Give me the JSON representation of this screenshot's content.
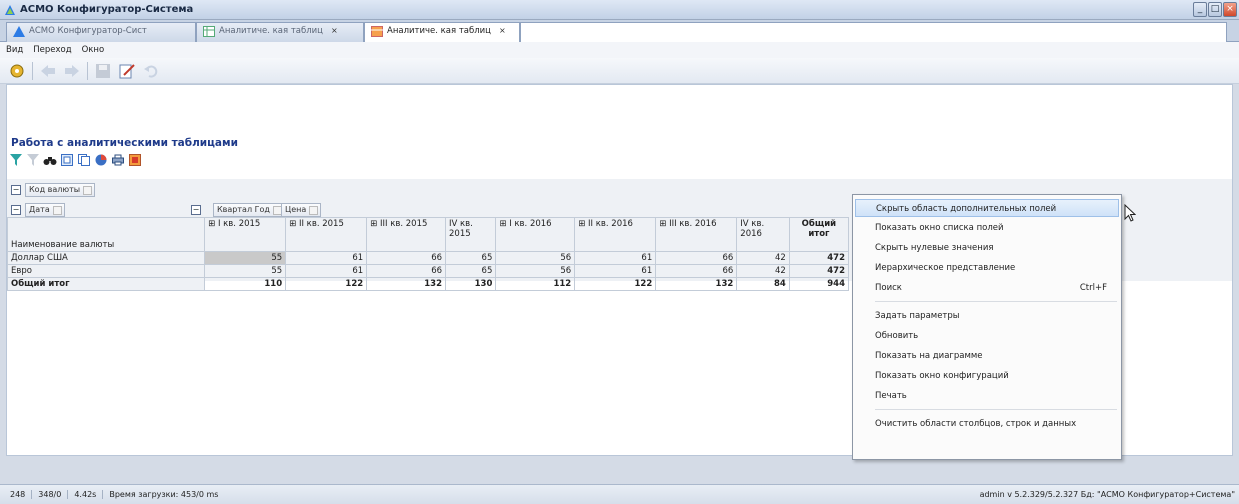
{
  "window": {
    "title": "АСМО Конфигуратор-Система",
    "buttons": [
      "_",
      "□",
      "×"
    ]
  },
  "tabs": [
    {
      "label": "АСМО Конфигуратор-Сист",
      "active": false,
      "closable": false
    },
    {
      "label": "Аналитиче. кая таблиц",
      "active": false,
      "closable": true
    },
    {
      "label": "Аналитиче. кая таблиц",
      "active": true,
      "closable": true
    }
  ],
  "menu": [
    "Вид",
    "Переход",
    "Окно"
  ],
  "page": {
    "heading": "Работа с аналитическими таблицами"
  },
  "fields": {
    "filter_field": "Код валюты",
    "row_field": "Дата",
    "column_fields": [
      "Квартал Год",
      "Цена"
    ],
    "row_header": "Наименование валюты"
  },
  "table": {
    "columns": [
      "I кв. 2015",
      "II кв. 2015",
      "III кв. 2015",
      "IV кв. 2015",
      "I кв. 2016",
      "II кв. 2016",
      "III кв. 2016",
      "IV кв. 2016",
      "Общий итог"
    ],
    "rows": [
      {
        "label": "Доллар США",
        "values": [
          "55",
          "61",
          "66",
          "65",
          "56",
          "61",
          "66",
          "42",
          "472"
        ]
      },
      {
        "label": "Евро",
        "values": [
          "55",
          "61",
          "66",
          "65",
          "56",
          "61",
          "66",
          "42",
          "472"
        ]
      },
      {
        "label": "Общий итог",
        "values": [
          "110",
          "122",
          "132",
          "130",
          "112",
          "122",
          "132",
          "84",
          "944"
        ]
      }
    ]
  },
  "context_menu": {
    "items": [
      {
        "label": "Скрыть область дополнительных полей",
        "highlighted": true,
        "shortcut": ""
      },
      {
        "label": "Показать окно списка полей",
        "highlighted": false,
        "shortcut": ""
      },
      {
        "label": "Скрыть нулевые значения",
        "highlighted": false,
        "shortcut": ""
      },
      {
        "label": "Иерархическое представление",
        "highlighted": false,
        "shortcut": ""
      },
      {
        "label": "Поиск",
        "highlighted": false,
        "shortcut": "Ctrl+F"
      },
      {
        "label": "Задать параметры",
        "highlighted": false,
        "shortcut": ""
      },
      {
        "label": "Обновить",
        "highlighted": false,
        "shortcut": ""
      },
      {
        "label": "Показать на диаграмме",
        "highlighted": false,
        "shortcut": ""
      },
      {
        "label": "Показать окно конфигураций",
        "highlighted": false,
        "shortcut": ""
      },
      {
        "label": "Печать",
        "highlighted": false,
        "shortcut": ""
      },
      {
        "label": "Очистить области столбцов, строк и данных",
        "highlighted": false,
        "shortcut": ""
      }
    ]
  },
  "status": {
    "left": [
      "248",
      "348/0",
      "4.42s",
      "Время загрузки: 453/0 ms"
    ],
    "right": "admin  v 5.2.329/5.2.327  Бд: \"АСМО Конфигуратор+Система\""
  },
  "colors": {
    "heading": "#1e3a8a",
    "highlight": "#cfe2f8",
    "selected_cell": "#c9c9c9"
  }
}
